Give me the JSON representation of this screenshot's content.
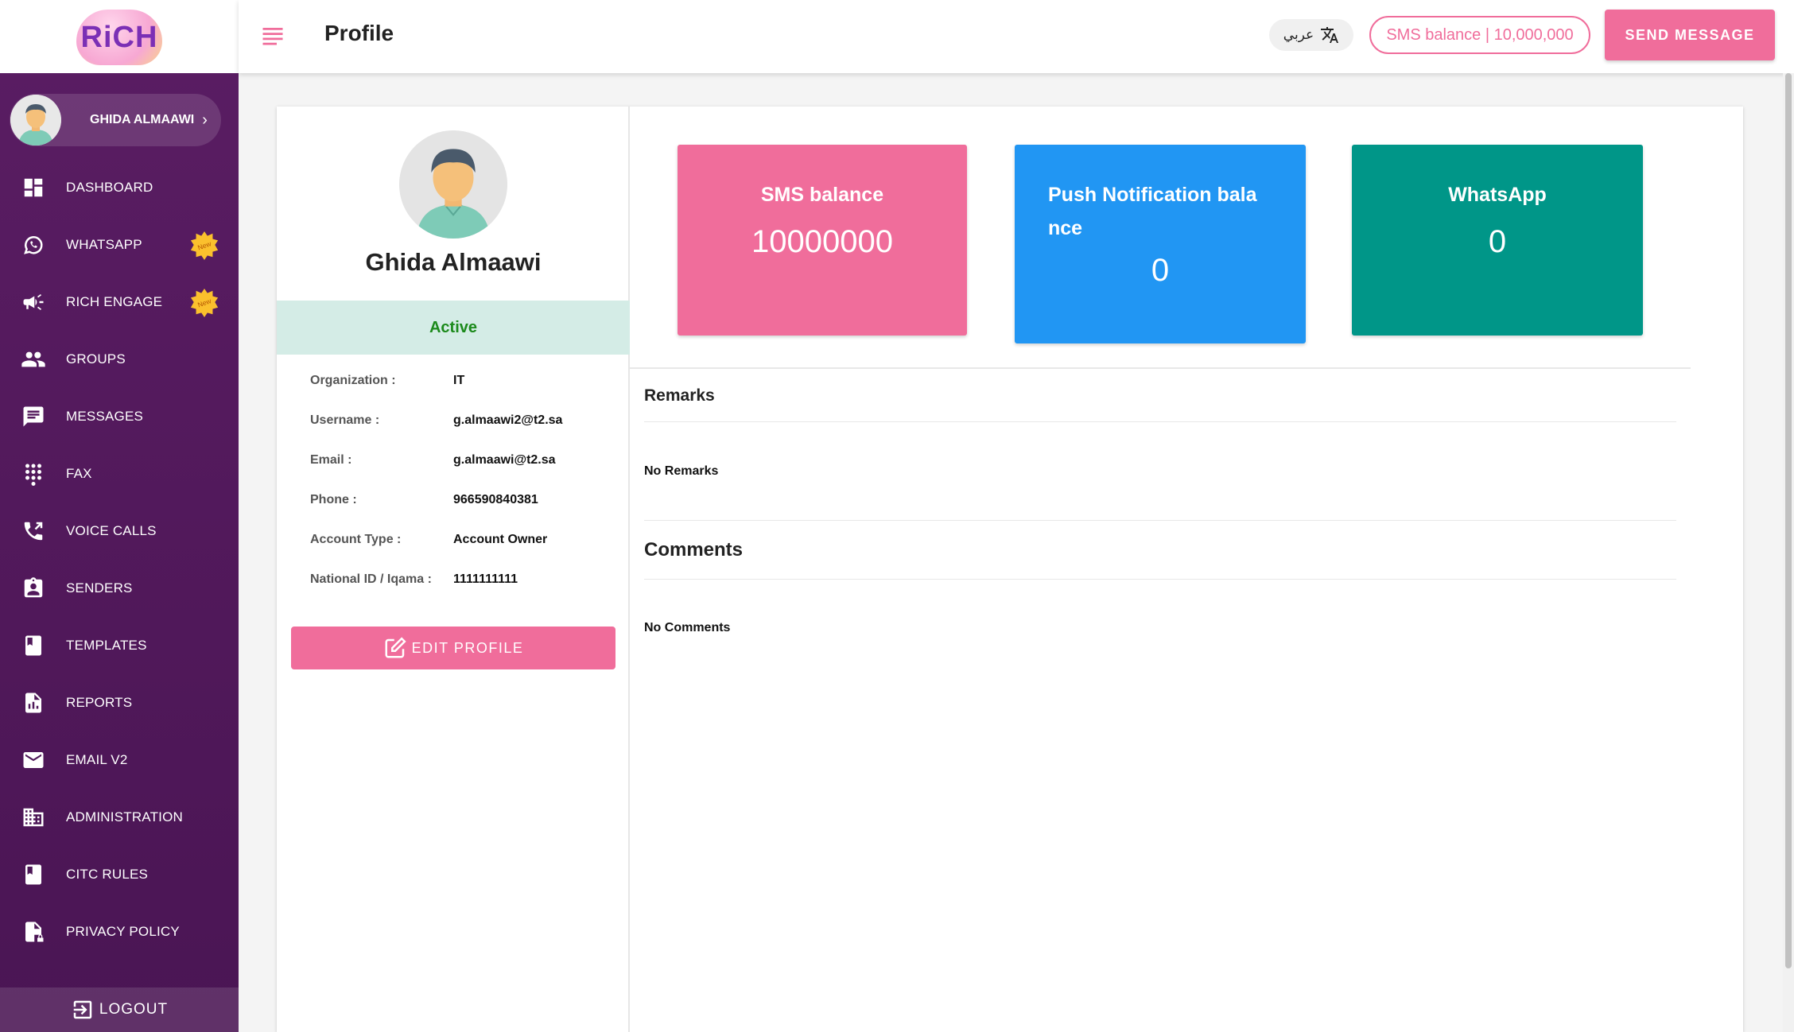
{
  "app": {
    "logo_text": "RiCH"
  },
  "header": {
    "title": "Profile",
    "lang_label": "عربي",
    "sms_balance_pill": "SMS balance | 10,000,000",
    "send_button": "SEND MESSAGE"
  },
  "sidebar": {
    "user_name": "GHIDA ALMAAWI",
    "items": [
      {
        "label": "DASHBOARD",
        "icon": "dashboard-icon"
      },
      {
        "label": "WHATSAPP",
        "icon": "whatsapp-icon",
        "badge": "New"
      },
      {
        "label": "RICH ENGAGE",
        "icon": "megaphone-icon",
        "badge": "New"
      },
      {
        "label": "GROUPS",
        "icon": "groups-icon"
      },
      {
        "label": "MESSAGES",
        "icon": "message-icon"
      },
      {
        "label": "FAX",
        "icon": "dialpad-icon"
      },
      {
        "label": "VOICE CALLS",
        "icon": "phone-icon"
      },
      {
        "label": "SENDERS",
        "icon": "badge-icon"
      },
      {
        "label": "TEMPLATES",
        "icon": "book-icon"
      },
      {
        "label": "REPORTS",
        "icon": "report-icon"
      },
      {
        "label": "EMAIL V2",
        "icon": "mail-icon"
      },
      {
        "label": "ADMINISTRATION",
        "icon": "building-icon"
      },
      {
        "label": "CITC RULES",
        "icon": "book-icon"
      },
      {
        "label": "PRIVACY POLICY",
        "icon": "lock-file-icon"
      }
    ],
    "logout": "LOGOUT"
  },
  "profile": {
    "name": "Ghida Almaawi",
    "status": "Active",
    "fields": [
      {
        "label": "Organization :",
        "value": "IT"
      },
      {
        "label": "Username :",
        "value": "g.almaawi2@t2.sa"
      },
      {
        "label": "Email :",
        "value": "g.almaawi@t2.sa"
      },
      {
        "label": "Phone :",
        "value": "966590840381"
      },
      {
        "label": "Account Type :",
        "value": "Account Owner"
      },
      {
        "label": "National ID / Iqama :",
        "value": "1111111111"
      }
    ],
    "edit_button": "EDIT PROFILE"
  },
  "stats": {
    "sms": {
      "title": "SMS balance",
      "value": "10000000",
      "color": "#f06d9b"
    },
    "push": {
      "title_line1": "Push Notification bala",
      "title_line2": "nce",
      "value": "0",
      "color": "#2196f3"
    },
    "whatsapp": {
      "title": "WhatsApp",
      "value": "0",
      "color": "#009688"
    }
  },
  "remarks": {
    "title": "Remarks",
    "text": "No Remarks"
  },
  "comments": {
    "title": "Comments",
    "text": "No Comments"
  }
}
